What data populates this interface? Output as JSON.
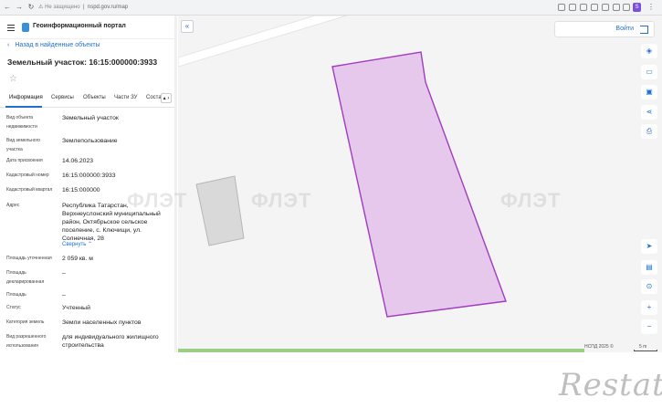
{
  "browser": {
    "security_text": "Не защищено",
    "url": "nspd.gov.ru/map",
    "profile_initial": "S"
  },
  "header": {
    "app_title": "Геоинформационный портал"
  },
  "panel": {
    "back_label": "Назад в найденные объекты",
    "object_title": "Земельный участок: 16:15:000000:3933",
    "tabs": [
      {
        "label": "Информация",
        "active": true
      },
      {
        "label": "Сервисы"
      },
      {
        "label": "Объекты"
      },
      {
        "label": "Части ЗУ"
      },
      {
        "label": "Состав"
      }
    ],
    "rows": [
      {
        "label": "Вид объекта недвижимости",
        "value": "Земельный участок"
      },
      {
        "label": "Вид земельного участка",
        "value": "Землепользование"
      },
      {
        "label": "Дата присвоения",
        "value": "14.06.2023"
      },
      {
        "label": "Кадастровый номер",
        "value": "16:15:000000:3933"
      },
      {
        "label": "Кадастровый квартал",
        "value": "16:15:000000"
      },
      {
        "label": "Адрес",
        "value": "Республика Татарстан, Верхнеуслонский муниципальный район, Октябрьское сельское поселение, с. Ключищи, ул. Солнечная, 28"
      },
      {
        "label": "Площадь уточненная",
        "value": "2 059 кв. м"
      },
      {
        "label": "Площадь декларированная",
        "value": "–"
      },
      {
        "label": "Площадь",
        "value": "–"
      },
      {
        "label": "Статус",
        "value": "Учтенный"
      },
      {
        "label": "Категория земель",
        "value": "Земли населенных пунктов"
      },
      {
        "label": "Вид разрешенного использования",
        "value": "для индивидуального жилищного строительства"
      }
    ],
    "collapse_label": "Свернуть"
  },
  "map": {
    "login_label": "Войти",
    "attribution": "НСПД 2025 ©",
    "scale_label": "5 m",
    "watermark_text": "ФЛЭТ",
    "parcel_fill": "#e6c8ec",
    "parcel_stroke": "#a23bbf"
  },
  "brand": {
    "name": "Restate"
  }
}
